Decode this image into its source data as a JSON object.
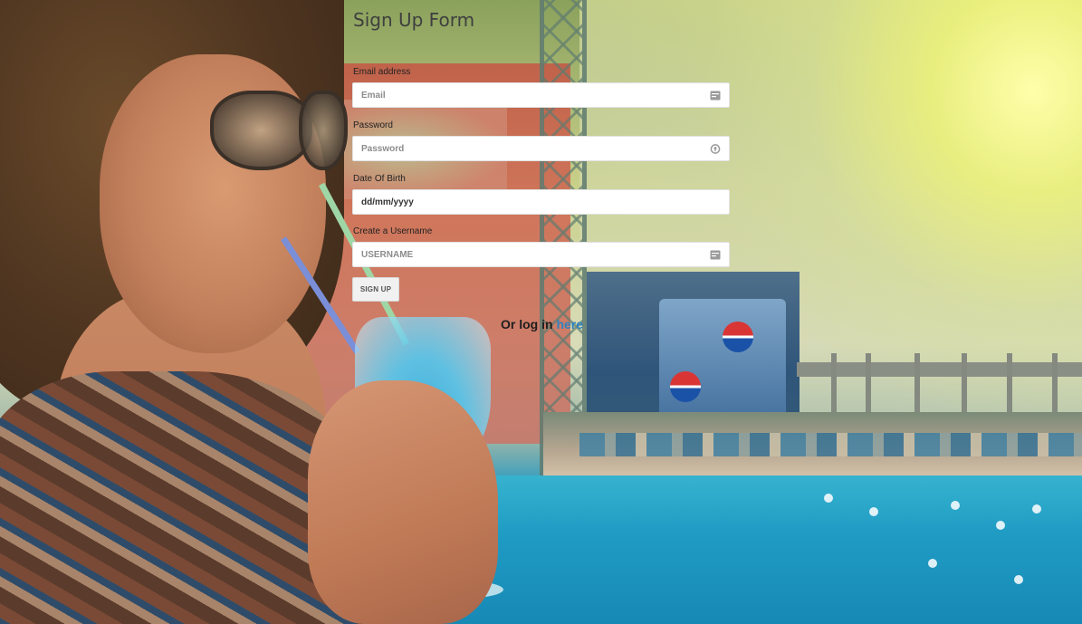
{
  "form": {
    "title": "Sign Up Form",
    "email": {
      "label": "Email address",
      "placeholder": "Email",
      "icon": "id-card-icon"
    },
    "password": {
      "label": "Password",
      "placeholder": "Password",
      "icon": "key-icon"
    },
    "dob": {
      "label": "Date Of Birth",
      "value": "dd/mm/yyyy"
    },
    "username": {
      "label": "Create a Username",
      "placeholder": "USERNAME",
      "icon": "id-card-icon"
    },
    "submit_label": "SIGN UP",
    "login_prefix": "Or log in",
    "login_link": "here"
  },
  "colors": {
    "link": "#2d83c0",
    "title": "#3f3f3f",
    "button_bg": "#f1f1f1"
  }
}
